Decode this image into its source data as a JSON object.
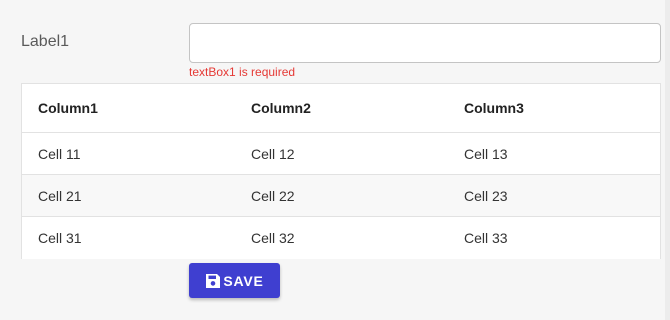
{
  "form": {
    "label": "Label1",
    "input_value": "",
    "error": "textBox1 is required"
  },
  "grid": {
    "columns": [
      "Column1",
      "Column2",
      "Column3"
    ],
    "rows": [
      [
        "Cell 11",
        "Cell 12",
        "Cell 13"
      ],
      [
        "Cell 21",
        "Cell 22",
        "Cell 23"
      ],
      [
        "Cell 31",
        "Cell 32",
        "Cell 33"
      ]
    ]
  },
  "actions": {
    "save_label": "SAVE",
    "save_icon": "floppy-disk-icon"
  },
  "colors": {
    "accent": "#3f3fd0",
    "error": "#e53935",
    "alt_row": "#f8f8f8"
  }
}
